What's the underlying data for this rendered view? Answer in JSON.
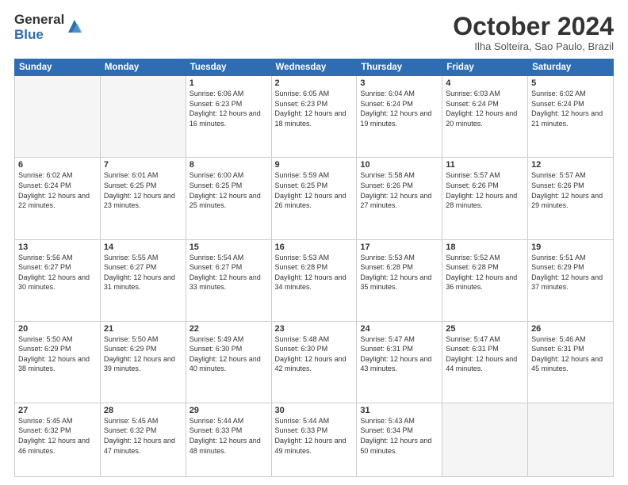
{
  "logo": {
    "general": "General",
    "blue": "Blue"
  },
  "header": {
    "month": "October 2024",
    "location": "Ilha Solteira, Sao Paulo, Brazil"
  },
  "weekdays": [
    "Sunday",
    "Monday",
    "Tuesday",
    "Wednesday",
    "Thursday",
    "Friday",
    "Saturday"
  ],
  "weeks": [
    [
      {
        "day": "",
        "info": ""
      },
      {
        "day": "",
        "info": ""
      },
      {
        "day": "1",
        "info": "Sunrise: 6:06 AM\nSunset: 6:23 PM\nDaylight: 12 hours and 16 minutes."
      },
      {
        "day": "2",
        "info": "Sunrise: 6:05 AM\nSunset: 6:23 PM\nDaylight: 12 hours and 18 minutes."
      },
      {
        "day": "3",
        "info": "Sunrise: 6:04 AM\nSunset: 6:24 PM\nDaylight: 12 hours and 19 minutes."
      },
      {
        "day": "4",
        "info": "Sunrise: 6:03 AM\nSunset: 6:24 PM\nDaylight: 12 hours and 20 minutes."
      },
      {
        "day": "5",
        "info": "Sunrise: 6:02 AM\nSunset: 6:24 PM\nDaylight: 12 hours and 21 minutes."
      }
    ],
    [
      {
        "day": "6",
        "info": "Sunrise: 6:02 AM\nSunset: 6:24 PM\nDaylight: 12 hours and 22 minutes."
      },
      {
        "day": "7",
        "info": "Sunrise: 6:01 AM\nSunset: 6:25 PM\nDaylight: 12 hours and 23 minutes."
      },
      {
        "day": "8",
        "info": "Sunrise: 6:00 AM\nSunset: 6:25 PM\nDaylight: 12 hours and 25 minutes."
      },
      {
        "day": "9",
        "info": "Sunrise: 5:59 AM\nSunset: 6:25 PM\nDaylight: 12 hours and 26 minutes."
      },
      {
        "day": "10",
        "info": "Sunrise: 5:58 AM\nSunset: 6:26 PM\nDaylight: 12 hours and 27 minutes."
      },
      {
        "day": "11",
        "info": "Sunrise: 5:57 AM\nSunset: 6:26 PM\nDaylight: 12 hours and 28 minutes."
      },
      {
        "day": "12",
        "info": "Sunrise: 5:57 AM\nSunset: 6:26 PM\nDaylight: 12 hours and 29 minutes."
      }
    ],
    [
      {
        "day": "13",
        "info": "Sunrise: 5:56 AM\nSunset: 6:27 PM\nDaylight: 12 hours and 30 minutes."
      },
      {
        "day": "14",
        "info": "Sunrise: 5:55 AM\nSunset: 6:27 PM\nDaylight: 12 hours and 31 minutes."
      },
      {
        "day": "15",
        "info": "Sunrise: 5:54 AM\nSunset: 6:27 PM\nDaylight: 12 hours and 33 minutes."
      },
      {
        "day": "16",
        "info": "Sunrise: 5:53 AM\nSunset: 6:28 PM\nDaylight: 12 hours and 34 minutes."
      },
      {
        "day": "17",
        "info": "Sunrise: 5:53 AM\nSunset: 6:28 PM\nDaylight: 12 hours and 35 minutes."
      },
      {
        "day": "18",
        "info": "Sunrise: 5:52 AM\nSunset: 6:28 PM\nDaylight: 12 hours and 36 minutes."
      },
      {
        "day": "19",
        "info": "Sunrise: 5:51 AM\nSunset: 6:29 PM\nDaylight: 12 hours and 37 minutes."
      }
    ],
    [
      {
        "day": "20",
        "info": "Sunrise: 5:50 AM\nSunset: 6:29 PM\nDaylight: 12 hours and 38 minutes."
      },
      {
        "day": "21",
        "info": "Sunrise: 5:50 AM\nSunset: 6:29 PM\nDaylight: 12 hours and 39 minutes."
      },
      {
        "day": "22",
        "info": "Sunrise: 5:49 AM\nSunset: 6:30 PM\nDaylight: 12 hours and 40 minutes."
      },
      {
        "day": "23",
        "info": "Sunrise: 5:48 AM\nSunset: 6:30 PM\nDaylight: 12 hours and 42 minutes."
      },
      {
        "day": "24",
        "info": "Sunrise: 5:47 AM\nSunset: 6:31 PM\nDaylight: 12 hours and 43 minutes."
      },
      {
        "day": "25",
        "info": "Sunrise: 5:47 AM\nSunset: 6:31 PM\nDaylight: 12 hours and 44 minutes."
      },
      {
        "day": "26",
        "info": "Sunrise: 5:46 AM\nSunset: 6:31 PM\nDaylight: 12 hours and 45 minutes."
      }
    ],
    [
      {
        "day": "27",
        "info": "Sunrise: 5:45 AM\nSunset: 6:32 PM\nDaylight: 12 hours and 46 minutes."
      },
      {
        "day": "28",
        "info": "Sunrise: 5:45 AM\nSunset: 6:32 PM\nDaylight: 12 hours and 47 minutes."
      },
      {
        "day": "29",
        "info": "Sunrise: 5:44 AM\nSunset: 6:33 PM\nDaylight: 12 hours and 48 minutes."
      },
      {
        "day": "30",
        "info": "Sunrise: 5:44 AM\nSunset: 6:33 PM\nDaylight: 12 hours and 49 minutes."
      },
      {
        "day": "31",
        "info": "Sunrise: 5:43 AM\nSunset: 6:34 PM\nDaylight: 12 hours and 50 minutes."
      },
      {
        "day": "",
        "info": ""
      },
      {
        "day": "",
        "info": ""
      }
    ]
  ]
}
